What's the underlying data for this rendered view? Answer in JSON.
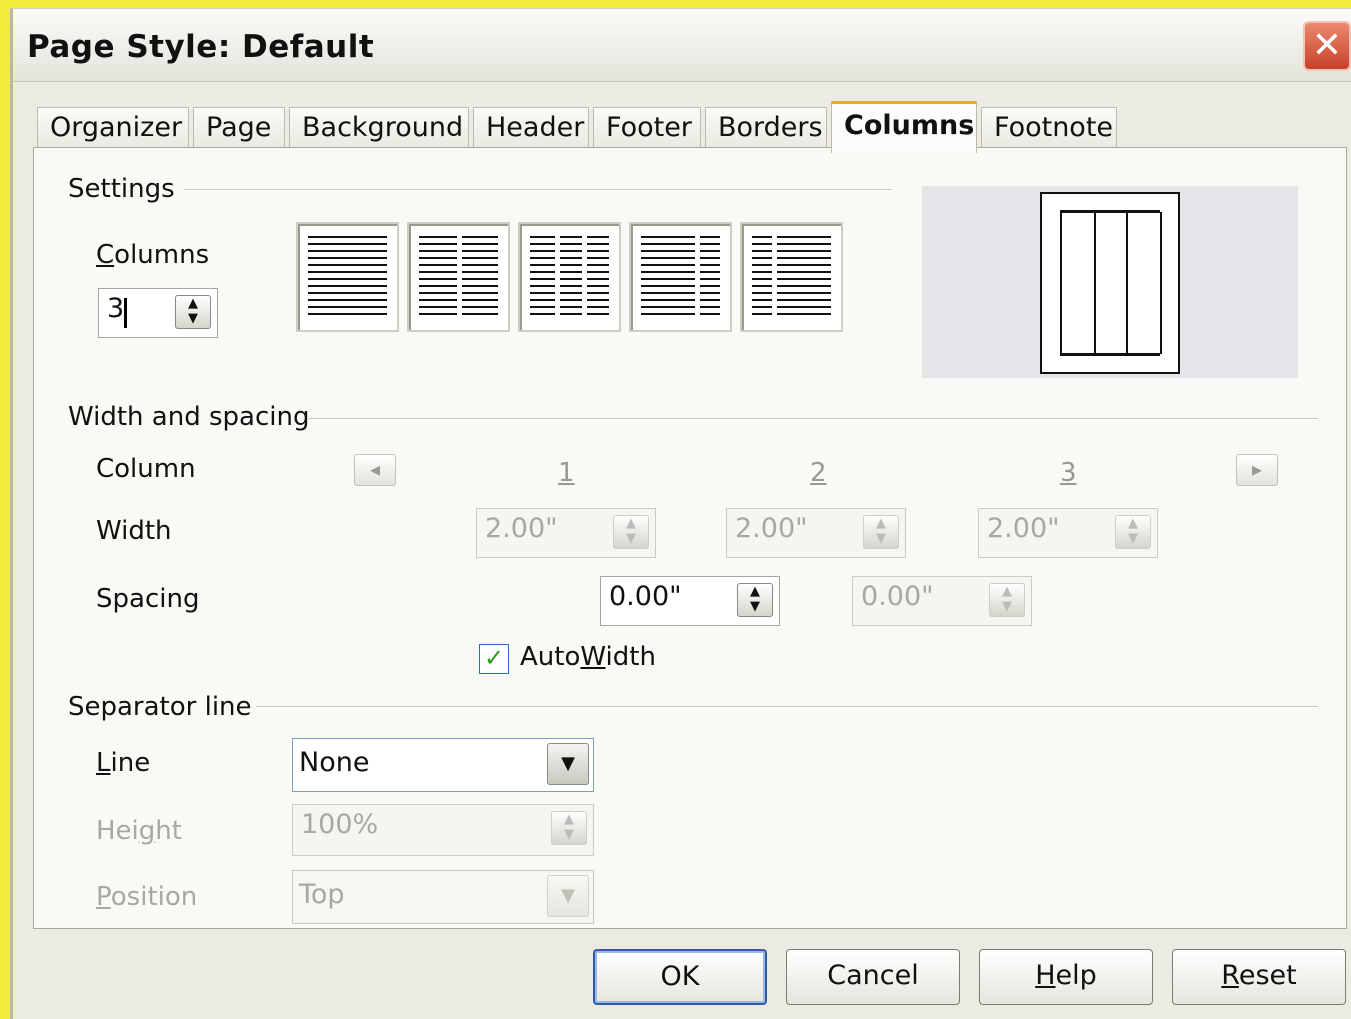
{
  "window": {
    "title": "Page Style: Default",
    "close_glyph": "✕"
  },
  "tabs": [
    {
      "label": "Organizer"
    },
    {
      "label": "Page"
    },
    {
      "label": "Background"
    },
    {
      "label": "Header"
    },
    {
      "label": "Footer"
    },
    {
      "label": "Borders"
    },
    {
      "label": "Columns",
      "active": true
    },
    {
      "label": "Footnote"
    }
  ],
  "settings": {
    "section_label": "Settings",
    "columns_label_first": "C",
    "columns_label_rest": "olumns",
    "columns_value": "3"
  },
  "width_spacing": {
    "section_label": "Width and spacing",
    "column_label": "Column",
    "width_label": "Width",
    "spacing_label": "Spacing",
    "column_numbers": [
      "1",
      "2",
      "3"
    ],
    "widths": [
      "2.00\"",
      "2.00\"",
      "2.00\""
    ],
    "spacings": [
      "0.00\"",
      "0.00\""
    ],
    "autowidth_pre": "Auto",
    "autowidth_u": "W",
    "autowidth_post": "idth",
    "autowidth_checked": true
  },
  "separator": {
    "section_label": "Separator line",
    "line_label_u": "L",
    "line_label_rest": "ine",
    "line_value": "None",
    "height_label_pre": "Hei",
    "height_label_u": "g",
    "height_label_post": "ht",
    "height_value": "100%",
    "position_label_u": "P",
    "position_label_rest": "osition",
    "position_value": "Top"
  },
  "buttons": {
    "ok": "OK",
    "cancel": "Cancel",
    "help_u": "H",
    "help_rest": "elp",
    "reset_u": "R",
    "reset_rest": "eset"
  }
}
